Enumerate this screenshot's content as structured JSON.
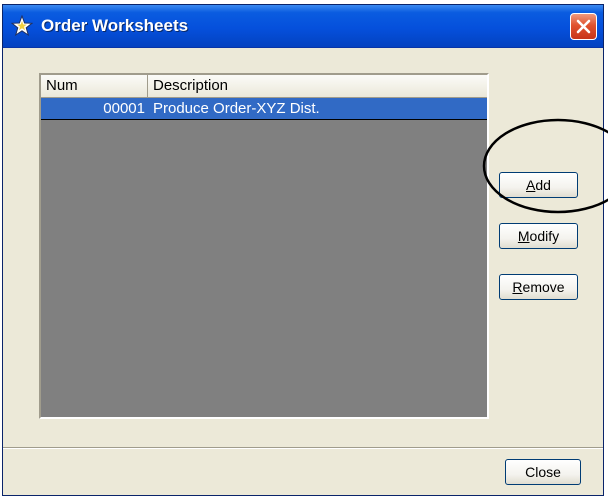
{
  "window": {
    "title": "Order Worksheets",
    "close_glyph": "×"
  },
  "list": {
    "columns": [
      "Num",
      "Description"
    ],
    "rows": [
      {
        "num": "00001",
        "description": "Produce Order-XYZ Dist.",
        "selected": true
      }
    ]
  },
  "buttons": {
    "add": {
      "mnemonic": "A",
      "rest": "dd"
    },
    "modify": {
      "mnemonic": "M",
      "rest": "odify"
    },
    "remove": {
      "mnemonic": "R",
      "rest": "emove"
    },
    "close": "Close"
  },
  "colors": {
    "titlebar": "#0550dc",
    "selection": "#316ac5",
    "dialog_bg": "#ece9d8",
    "list_empty_bg": "#808080"
  },
  "icons": [
    "worksheet-star-icon",
    "close-icon"
  ]
}
